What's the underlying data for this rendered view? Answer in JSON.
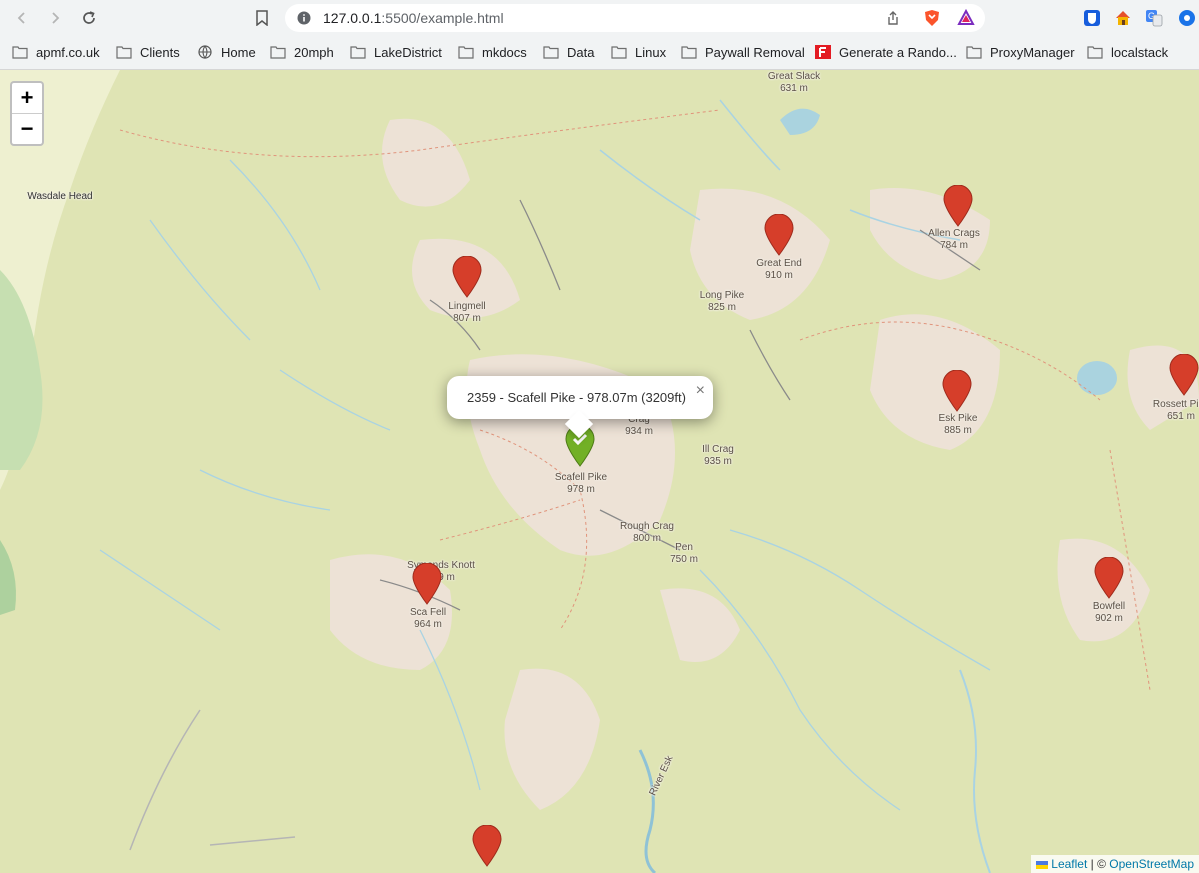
{
  "browser": {
    "url_host": "127.0.0.1",
    "url_rest": ":5500/example.html"
  },
  "bookmarks": [
    {
      "label": "apmf.co.uk",
      "icon": "folder-icon"
    },
    {
      "label": "Clients",
      "icon": "folder-icon"
    },
    {
      "label": "Home",
      "icon": "globe-icon"
    },
    {
      "label": "20mph",
      "icon": "folder-icon"
    },
    {
      "label": "LakeDistrict",
      "icon": "folder-icon"
    },
    {
      "label": "mkdocs",
      "icon": "folder-icon"
    },
    {
      "label": "Data",
      "icon": "folder-icon"
    },
    {
      "label": "Linux",
      "icon": "folder-icon"
    },
    {
      "label": "Paywall Removal",
      "icon": "folder-icon"
    },
    {
      "label": "Generate a Rando...",
      "icon": "f-brand-icon"
    },
    {
      "label": "ProxyManager",
      "icon": "folder-icon"
    },
    {
      "label": "localstack",
      "icon": "folder-icon"
    }
  ],
  "map": {
    "zoom_in": "+",
    "zoom_out": "−",
    "popup": {
      "text": "2359 - Scafell Pike - 978.07m (3209ft)",
      "close": "×"
    },
    "attribution": {
      "leaflet": "Leaflet",
      "separator": " | © ",
      "osm": "OpenStreetMap"
    },
    "colors": {
      "marker_red": "#d63e2a",
      "marker_green": "#72b026",
      "land": "#dfe4b4",
      "rock": "#ede2d6",
      "water": "#aad3df"
    },
    "labels": [
      {
        "name": "Great Slack",
        "elev": "631 m"
      },
      {
        "name": "Wasdale Head",
        "elev": ""
      },
      {
        "name": "Allen Crags",
        "elev": "784 m"
      },
      {
        "name": "Great End",
        "elev": "910 m"
      },
      {
        "name": "Long Pike",
        "elev": "825 m"
      },
      {
        "name": "Lingmell",
        "elev": "807 m"
      },
      {
        "name": "Esk Pike",
        "elev": "885 m"
      },
      {
        "name": "Rossett Pike",
        "elev": "651 m"
      },
      {
        "name": "Crag",
        "elev": "934 m"
      },
      {
        "name": "Ill Crag",
        "elev": "935 m"
      },
      {
        "name": "Scafell Pike",
        "elev": "978 m"
      },
      {
        "name": "Rough Crag",
        "elev": "800 m"
      },
      {
        "name": "Pen",
        "elev": "750 m"
      },
      {
        "name": "Symonds Knott",
        "elev": "959 m"
      },
      {
        "name": "Sca Fell",
        "elev": "964 m"
      },
      {
        "name": "Bowfell",
        "elev": "902 m"
      },
      {
        "name": "River Esk",
        "elev": ""
      },
      {
        "name": "Wasdale",
        "elev": ""
      }
    ],
    "markers": [
      {
        "name": "Lingmell",
        "color": "red"
      },
      {
        "name": "Great End",
        "color": "red"
      },
      {
        "name": "Allen Crags",
        "color": "red"
      },
      {
        "name": "Esk Pike",
        "color": "red"
      },
      {
        "name": "Rossett Pike",
        "color": "red"
      },
      {
        "name": "Scafell Pike",
        "color": "green"
      },
      {
        "name": "Sca Fell",
        "color": "red"
      },
      {
        "name": "Bowfell",
        "color": "red"
      },
      {
        "name": "Unnamed summit",
        "color": "red"
      }
    ]
  }
}
